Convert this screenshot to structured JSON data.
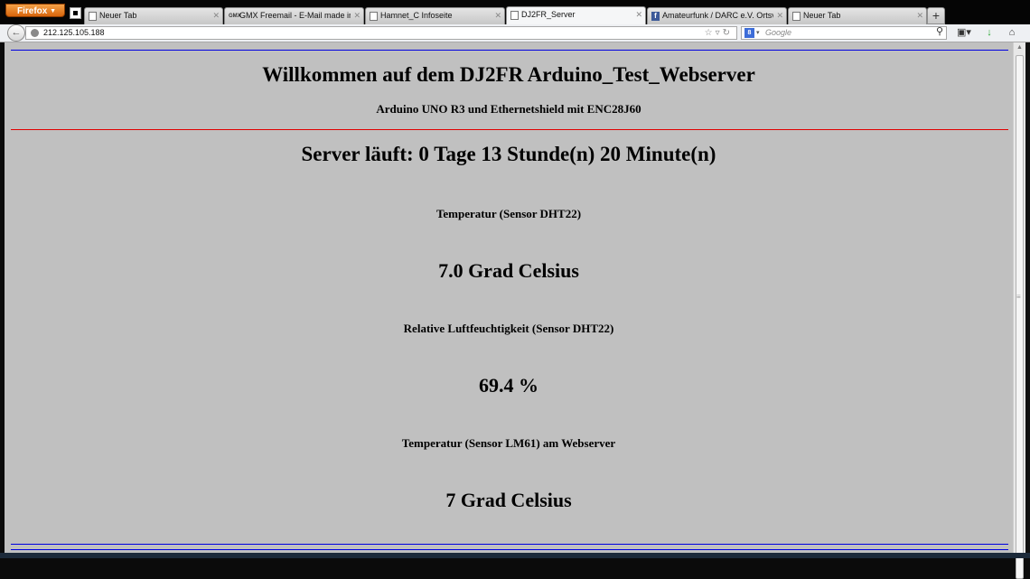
{
  "browser": {
    "menu_button": "Firefox",
    "tabs": [
      {
        "title": "Neuer Tab",
        "favicon": "blank-page-icon",
        "active": false
      },
      {
        "title": "GMX Freemail - E-Mail made in ...",
        "favicon": "gmx-icon",
        "active": false
      },
      {
        "title": "Hamnet_C Infoseite",
        "favicon": "blank-page-icon",
        "active": false
      },
      {
        "title": "DJ2FR_Server",
        "favicon": "blank-page-icon",
        "active": true
      },
      {
        "title": "Amateurfunk / DARC e.V. Ortsv...",
        "favicon": "facebook-icon",
        "active": false
      },
      {
        "title": "Neuer Tab",
        "favicon": "blank-page-icon",
        "active": false
      }
    ],
    "gmx_favicon_text": "GMX",
    "address": "212.125.105.188",
    "search": {
      "engine_icon_text": "8",
      "placeholder": "Google"
    },
    "accent_colors": {
      "firefox_button": "#e8791c",
      "download_arrow": "#2aa832"
    }
  },
  "page": {
    "title": "Willkommen auf dem DJ2FR Arduino_Test_Webserver",
    "subtitle": "Arduino UNO R3 und Ethernetshield mit ENC28J60",
    "uptime": "Server läuft: 0 Tage 13 Stunde(n) 20 Minute(n)",
    "sensors": [
      {
        "label": "Temperatur (Sensor DHT22)",
        "value": "7.0 Grad Celsius"
      },
      {
        "label": "Relative Luftfeuchtigkeit (Sensor DHT22)",
        "value": "69.4 %"
      },
      {
        "label": "Temperatur (Sensor LM61) am Webserver",
        "value": "7 Grad Celsius"
      }
    ],
    "colors": {
      "background": "#c0c0c0",
      "rule_blue": "#0000e0",
      "rule_red": "#e00000"
    }
  }
}
